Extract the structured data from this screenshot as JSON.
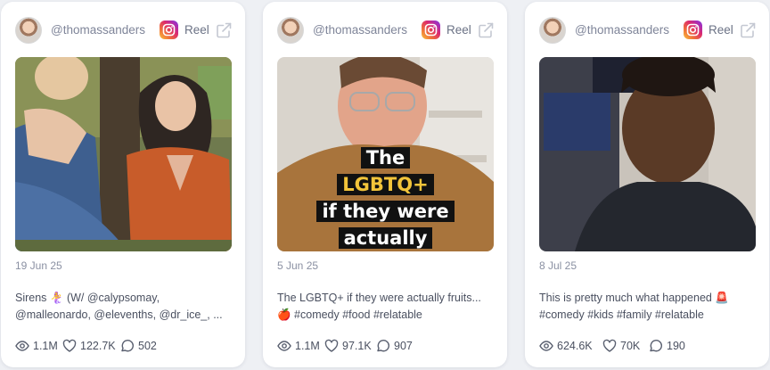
{
  "cards": [
    {
      "handle": "@thomassanders",
      "platform_icon": "instagram-icon",
      "type": "Reel",
      "date": "19 Jun 25",
      "caption_line1": "Sirens 🧜‍♀️ (W/ @calypsomay,",
      "caption_line2": "@malleonardo, @elevenths, @dr_ice_, ...",
      "views": "1.1M",
      "likes": "122.7K",
      "comments": "502"
    },
    {
      "handle": "@thomassanders",
      "platform_icon": "instagram-icon",
      "type": "Reel",
      "date": "5 Jun 25",
      "caption_line1": "The LGBTQ+ if they were actually fruits...",
      "caption_line2": "🍎 #comedy #food #relatable",
      "overlay_line1": "The",
      "overlay_line2": "LGBTQ+",
      "overlay_line3": "if they were",
      "overlay_line4": "actually",
      "views": "1.1M",
      "likes": "97.1K",
      "comments": "907"
    },
    {
      "handle": "@thomassanders",
      "platform_icon": "instagram-icon",
      "type": "Reel",
      "date": "8 Jul 25",
      "caption_line1": "This is pretty much what happened 🚨",
      "caption_line2": "#comedy #kids #family #relatable",
      "views": "624.6K",
      "likes": "70K",
      "comments": "190"
    }
  ]
}
